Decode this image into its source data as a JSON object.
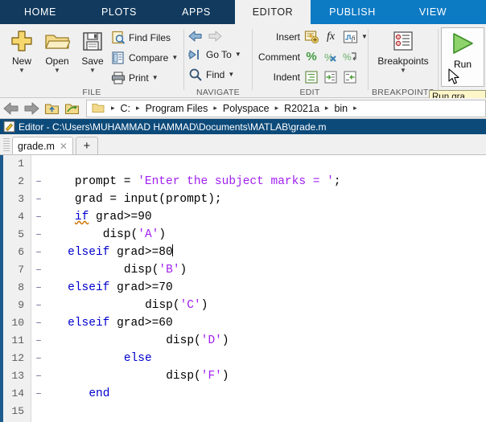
{
  "ribbon_tabs": [
    {
      "label": "HOME",
      "active": false
    },
    {
      "label": "PLOTS",
      "active": false
    },
    {
      "label": "APPS",
      "active": false
    },
    {
      "label": "EDITOR",
      "active": true
    },
    {
      "label": "PUBLISH",
      "active": false
    },
    {
      "label": "VIEW",
      "active": false
    }
  ],
  "file_group": {
    "label": "FILE",
    "new_label": "New",
    "open_label": "Open",
    "save_label": "Save",
    "find_files_label": "Find Files",
    "compare_label": "Compare",
    "print_label": "Print"
  },
  "navigate_group": {
    "label": "NAVIGATE",
    "go_to_label": "Go To",
    "find_label": "Find"
  },
  "edit_group": {
    "label": "EDIT",
    "insert_label": "Insert",
    "comment_label": "Comment",
    "indent_label": "Indent",
    "fx_label": "fx",
    "fi_label": "fi",
    "percent_label": "%"
  },
  "breakpoints_group": {
    "label": "BREAKPOINTS",
    "button_label": "Breakpoints"
  },
  "run_group": {
    "run_label": "Run",
    "tooltip": "Run gra"
  },
  "pathbar": {
    "crumbs": [
      "C:",
      "Program Files",
      "Polyspace",
      "R2021a",
      "bin"
    ],
    "separator": "▸"
  },
  "titlebar": {
    "text": "Editor - C:\\Users\\MUHAMMAD HAMMAD\\Documents\\MATLAB\\grade.m"
  },
  "doctabs": {
    "tab_label": "grade.m",
    "close_glyph": "✕",
    "new_tab_glyph": "+"
  },
  "code": {
    "lines": [
      {
        "num": "1",
        "breakpoint": false,
        "indent": 0,
        "segments": []
      },
      {
        "num": "2",
        "breakpoint": true,
        "indent": 4,
        "segments": [
          {
            "t": "prompt = ",
            "c": "plain"
          },
          {
            "t": "'Enter the subject marks = '",
            "c": "str"
          },
          {
            "t": ";",
            "c": "plain"
          }
        ]
      },
      {
        "num": "3",
        "breakpoint": true,
        "indent": 4,
        "segments": [
          {
            "t": "grad = input(prompt);",
            "c": "plain"
          }
        ]
      },
      {
        "num": "4",
        "breakpoint": true,
        "indent": 4,
        "segments": [
          {
            "t": "if",
            "c": "kw-err"
          },
          {
            "t": " grad>=90",
            "c": "plain"
          }
        ]
      },
      {
        "num": "5",
        "breakpoint": true,
        "indent": 8,
        "segments": [
          {
            "t": "disp(",
            "c": "plain"
          },
          {
            "t": "'A'",
            "c": "str"
          },
          {
            "t": ")",
            "c": "plain"
          }
        ]
      },
      {
        "num": "6",
        "breakpoint": true,
        "indent": 3,
        "segments": [
          {
            "t": "elseif",
            "c": "kw"
          },
          {
            "t": " grad>=80",
            "c": "plain"
          },
          {
            "t": "",
            "c": "caret"
          }
        ]
      },
      {
        "num": "7",
        "breakpoint": true,
        "indent": 11,
        "segments": [
          {
            "t": "disp(",
            "c": "plain"
          },
          {
            "t": "'B'",
            "c": "str"
          },
          {
            "t": ")",
            "c": "plain"
          }
        ]
      },
      {
        "num": "8",
        "breakpoint": true,
        "indent": 3,
        "segments": [
          {
            "t": "elseif",
            "c": "kw"
          },
          {
            "t": " grad>=70",
            "c": "plain"
          }
        ]
      },
      {
        "num": "9",
        "breakpoint": true,
        "indent": 14,
        "segments": [
          {
            "t": "disp(",
            "c": "plain"
          },
          {
            "t": "'C'",
            "c": "str"
          },
          {
            "t": ")",
            "c": "plain"
          }
        ]
      },
      {
        "num": "10",
        "breakpoint": true,
        "indent": 3,
        "segments": [
          {
            "t": "elseif",
            "c": "kw"
          },
          {
            "t": " grad>=60",
            "c": "plain"
          }
        ]
      },
      {
        "num": "11",
        "breakpoint": true,
        "indent": 17,
        "segments": [
          {
            "t": "disp(",
            "c": "plain"
          },
          {
            "t": "'D'",
            "c": "str"
          },
          {
            "t": ")",
            "c": "plain"
          }
        ]
      },
      {
        "num": "12",
        "breakpoint": true,
        "indent": 11,
        "segments": [
          {
            "t": "else",
            "c": "kw"
          }
        ]
      },
      {
        "num": "13",
        "breakpoint": true,
        "indent": 17,
        "segments": [
          {
            "t": "disp(",
            "c": "plain"
          },
          {
            "t": "'F'",
            "c": "str"
          },
          {
            "t": ")",
            "c": "plain"
          }
        ]
      },
      {
        "num": "14",
        "breakpoint": true,
        "indent": 6,
        "segments": [
          {
            "t": "end",
            "c": "kw"
          }
        ]
      },
      {
        "num": "15",
        "breakpoint": false,
        "indent": 0,
        "segments": []
      }
    ],
    "breakpoint_glyph": "–"
  },
  "colors": {
    "ribbon_dark": "#123a5e",
    "ribbon_blue": "#0d7ac4",
    "title_blue": "#0c4a7a",
    "keyword": "#0000cc",
    "string": "#a020f0",
    "run_green": "#4aa83a"
  }
}
